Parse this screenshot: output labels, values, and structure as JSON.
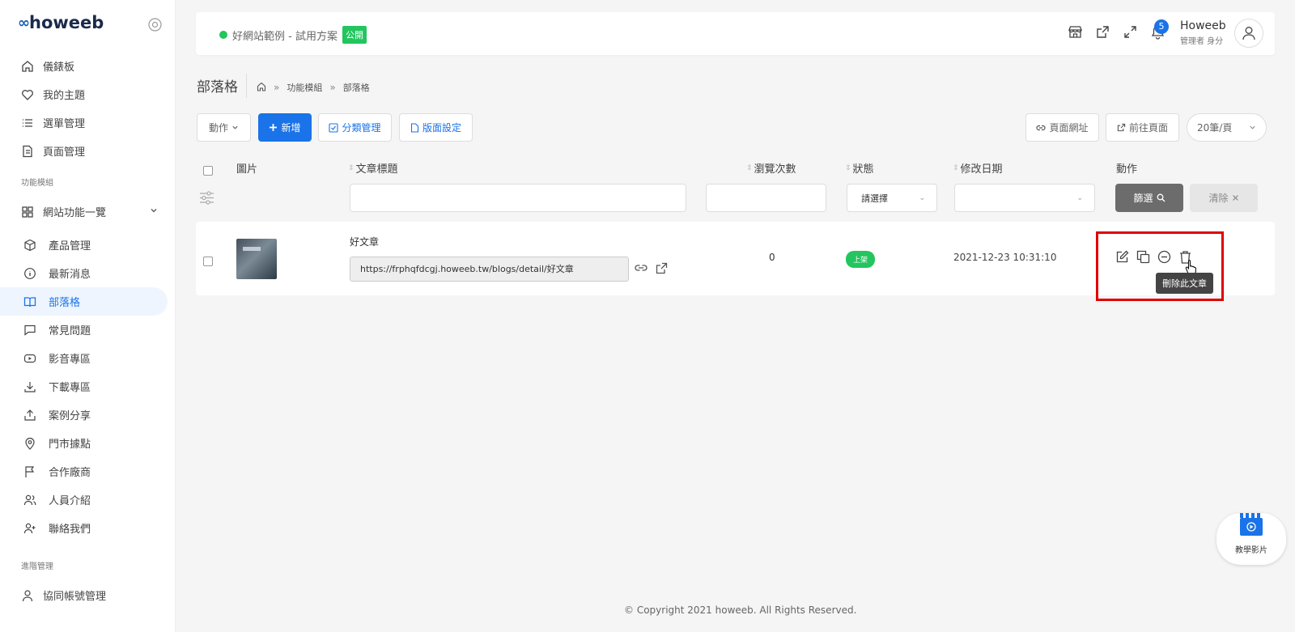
{
  "brand": {
    "mark": "∞",
    "name": "howeeb"
  },
  "sidebar": {
    "top_items": [
      {
        "label": "儀錶板",
        "icon": "home-icon"
      },
      {
        "label": "我的主題",
        "icon": "heart-icon"
      },
      {
        "label": "選單管理",
        "icon": "list-icon"
      },
      {
        "label": "頁面管理",
        "icon": "file-icon"
      }
    ],
    "section_modules": "功能模組",
    "group_label": "網站功能一覽",
    "module_items": [
      {
        "label": "產品管理",
        "icon": "box-icon"
      },
      {
        "label": "最新消息",
        "icon": "info-icon"
      },
      {
        "label": "部落格",
        "icon": "book-icon"
      },
      {
        "label": "常見問題",
        "icon": "message-icon"
      },
      {
        "label": "影音專區",
        "icon": "youtube-icon"
      },
      {
        "label": "下載專區",
        "icon": "download-icon"
      },
      {
        "label": "案例分享",
        "icon": "share-icon"
      },
      {
        "label": "門市據點",
        "icon": "map-pin-icon"
      },
      {
        "label": "合作廠商",
        "icon": "flag-icon"
      },
      {
        "label": "人員介紹",
        "icon": "users-icon"
      },
      {
        "label": "聯絡我們",
        "icon": "user-plus-icon"
      }
    ],
    "section_admin": "進階管理",
    "admin_items": [
      {
        "label": "協同帳號管理",
        "icon": "user-icon"
      }
    ]
  },
  "topbar": {
    "site_name": "好網站範例 - 試用方案",
    "public_badge": "公開",
    "notification_count": "5",
    "user_name": "Howeeb",
    "user_role": "管理者 身分"
  },
  "page": {
    "title": "部落格",
    "breadcrumb": [
      "功能模組",
      "部落格"
    ]
  },
  "toolbar": {
    "action_label": "動作",
    "add_label": "新增",
    "category_label": "分類管理",
    "layout_label": "版面設定",
    "page_url_label": "頁面網址",
    "goto_page_label": "前往頁面",
    "per_page_label": "20筆/頁"
  },
  "table": {
    "headers": {
      "image": "圖片",
      "title": "文章標題",
      "views": "瀏覽次數",
      "status": "狀態",
      "modified": "修改日期",
      "action": "動作"
    },
    "filter": {
      "status_placeholder": "請選擇",
      "filter_button": "篩選",
      "clear_button": "清除"
    },
    "rows": [
      {
        "title": "好文章",
        "url": "https://frphqfdcgj.howeeb.tw/blogs/detail/好文章",
        "views": "0",
        "status": "上架",
        "modified": "2021-12-23 10:31:10"
      }
    ]
  },
  "tooltip": "刪除此文章",
  "footer": {
    "copyright": "© Copyright 2021 howeeb. All Rights Reserved."
  },
  "tutorial": {
    "label": "教學影片"
  },
  "colors": {
    "accent": "#1a73e8",
    "success": "#22c55e",
    "highlight": "#e00000"
  }
}
